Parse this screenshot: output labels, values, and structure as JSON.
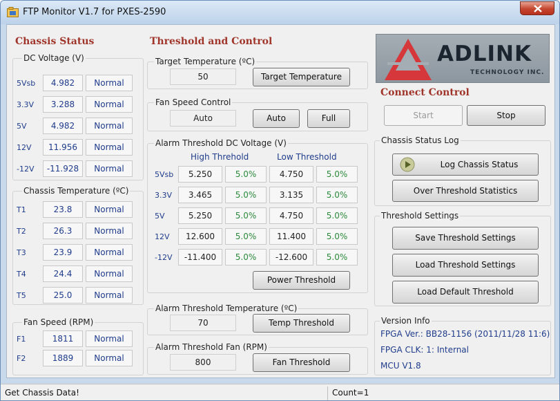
{
  "window": {
    "title": "FTP Monitor V1.7 for  PXES-2590"
  },
  "chassis_status": {
    "heading": "Chassis Status",
    "dc_voltage": {
      "label": "DC Voltage (V)",
      "rows": [
        {
          "name": "5Vsb",
          "value": "4.982",
          "status": "Normal"
        },
        {
          "name": "3.3V",
          "value": "3.288",
          "status": "Normal"
        },
        {
          "name": "5V",
          "value": "4.982",
          "status": "Normal"
        },
        {
          "name": "12V",
          "value": "11.956",
          "status": "Normal"
        },
        {
          "name": "-12V",
          "value": "-11.928",
          "status": "Normal"
        }
      ]
    },
    "temperature": {
      "label": "Chassis Temperature (ºC)",
      "rows": [
        {
          "name": "T1",
          "value": "23.8",
          "status": "Normal"
        },
        {
          "name": "T2",
          "value": "26.3",
          "status": "Normal"
        },
        {
          "name": "T3",
          "value": "23.9",
          "status": "Normal"
        },
        {
          "name": "T4",
          "value": "24.4",
          "status": "Normal"
        },
        {
          "name": "T5",
          "value": "25.0",
          "status": "Normal"
        }
      ]
    },
    "fan_speed": {
      "label": "Fan Speed (RPM)",
      "rows": [
        {
          "name": "F1",
          "value": "1811",
          "status": "Normal"
        },
        {
          "name": "F2",
          "value": "1889",
          "status": "Normal"
        }
      ]
    }
  },
  "threshold_control": {
    "heading": "Threshold and Control",
    "target_temperature": {
      "label": "Target Temperature (ºC)",
      "value": "50",
      "button": "Target Temperature"
    },
    "fan_speed_control": {
      "label": "Fan Speed Control",
      "value": "Auto",
      "auto_button": "Auto",
      "full_button": "Full"
    },
    "alarm_dc": {
      "label": "Alarm Threshold DC Voltage (V)",
      "high_header": "High Threhold",
      "low_header": "Low Threshold",
      "rows": [
        {
          "name": "5Vsb",
          "high": "5.250",
          "high_pct": "5.0%",
          "low": "4.750",
          "low_pct": "5.0%"
        },
        {
          "name": "3.3V",
          "high": "3.465",
          "high_pct": "5.0%",
          "low": "3.135",
          "low_pct": "5.0%"
        },
        {
          "name": "5V",
          "high": "5.250",
          "high_pct": "5.0%",
          "low": "4.750",
          "low_pct": "5.0%"
        },
        {
          "name": "12V",
          "high": "12.600",
          "high_pct": "5.0%",
          "low": "11.400",
          "low_pct": "5.0%"
        },
        {
          "name": "-12V",
          "high": "-11.400",
          "high_pct": "5.0%",
          "low": "-12.600",
          "low_pct": "5.0%"
        }
      ],
      "button": "Power Threshold"
    },
    "alarm_temp": {
      "label": "Alarm Threshold Temperature (ºC)",
      "value": "70",
      "button": "Temp Threshold"
    },
    "alarm_fan": {
      "label": "Alarm Threshold Fan (RPM)",
      "value": "800",
      "button": "Fan Threshold"
    }
  },
  "logo": {
    "name": "ADLINK",
    "sub": "TECHNOLOGY INC."
  },
  "connect": {
    "heading": "Connect Control",
    "start": "Start",
    "stop": "Stop"
  },
  "log": {
    "label": "Chassis Status Log",
    "log_button": "Log Chassis Status",
    "stats_button": "Over Threshold Statistics"
  },
  "settings": {
    "label": "Threshold Settings",
    "save": "Save Threshold Settings",
    "load": "Load Threshold Settings",
    "default": "Load Default Threshold"
  },
  "version": {
    "label": "Version Info",
    "fpga_ver": "FPGA Ver.: BB28-1156 (2011/11/28 11:6)",
    "fpga_clk": "FPGA CLK: 1: Internal",
    "mcu": "MCU V1.8"
  },
  "status": {
    "message": "Get Chassis Data!",
    "count": "Count=1"
  }
}
